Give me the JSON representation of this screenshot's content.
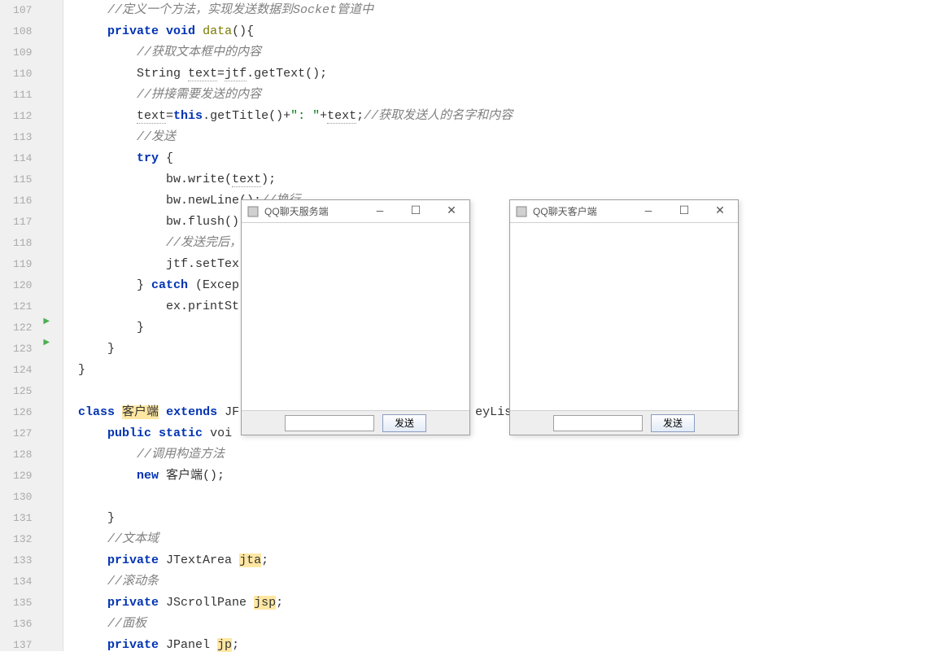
{
  "lines": {
    "start": 107,
    "end": 137
  },
  "code": {
    "l107_cmt": "//定义一个方法，实现发送数据到Socket管道中",
    "l108_a": "private",
    "l108_b": "void",
    "l108_c": "data",
    "l108_d": "(){",
    "l109_cmt": "//获取文本框中的内容",
    "l110_a": "String ",
    "l110_b": "text",
    "l110_c": "=",
    "l110_d": "jtf",
    "l110_e": ".getText();",
    "l111_cmt": "//拼接需要发送的内容",
    "l112_a": "text",
    "l112_b": "=",
    "l112_c": "this",
    "l112_d": ".getTitle()+",
    "l112_e": "\": \"",
    "l112_f": "+",
    "l112_g": "text",
    "l112_h": ";",
    "l112_cmt": "//获取发送人的名字和内容",
    "l113_cmt": "//发送",
    "l114_a": "try",
    "l114_b": " {",
    "l115_a": "bw",
    "l115_b": ".write(",
    "l115_c": "text",
    "l115_d": ");",
    "l116_a": "bw",
    "l116_b": ".newLine();",
    "l116_cmt": "//换行",
    "l117_a": "bw",
    "l117_b": ".flush()",
    "l118_cmt": "//发送完后，",
    "l119_a": "jtf",
    "l119_b": ".setTex",
    "l120_a": "} ",
    "l120_b": "catch",
    "l120_c": " (Excep",
    "l121_a": "ex.printSt",
    "l122_a": "}",
    "l123_a": "}",
    "l124_a": "}",
    "l126_a": "class",
    "l126_b": " ",
    "l126_c": "客户端",
    "l126_d": " ",
    "l126_e": "extends",
    "l126_f": " JF",
    "l126_tail": "eyLis",
    "l127_a": "public",
    "l127_b": " ",
    "l127_c": "static",
    "l127_d": " voi",
    "l128_cmt": "//调用构造方法",
    "l129_a": "new",
    "l129_b": " 客户端();",
    "l131_a": "}",
    "l132_cmt": "//文本域",
    "l133_a": "private",
    "l133_b": " JTextArea ",
    "l133_c": "jta",
    "l133_d": ";",
    "l134_cmt": "//滚动条",
    "l135_a": "private",
    "l135_b": " JScrollPane ",
    "l135_c": "jsp",
    "l135_d": ";",
    "l136_cmt": "//面板",
    "l137_a": "private",
    "l137_b": " JPanel ",
    "l137_c": "jp",
    "l137_d": ";"
  },
  "windows": {
    "server": {
      "title": "QQ聊天服务端",
      "send": "发送"
    },
    "client": {
      "title": "QQ聊天客户端",
      "send": "发送"
    }
  },
  "winbtn": {
    "min": "—",
    "max": "☐",
    "close": "✕"
  }
}
